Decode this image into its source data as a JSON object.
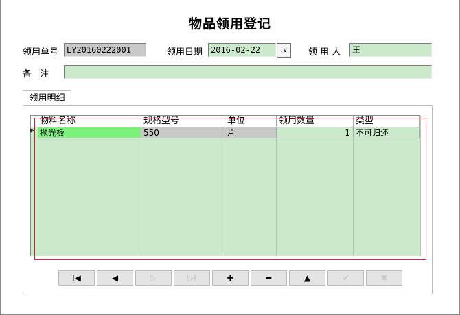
{
  "form": {
    "title": "物品领用登记",
    "doc_no_label": "领用单号",
    "doc_no_value": "LY20160222001",
    "date_label": "领用日期",
    "date_value": "2016-02-22",
    "recipient_label": "领 用 人",
    "recipient_value": "王",
    "remark_label": "备   注",
    "remark_value": ""
  },
  "tab": {
    "label": "领用明细"
  },
  "grid": {
    "columns": [
      "物料名称",
      "规格型号",
      "单位",
      "领用数量",
      "类型"
    ],
    "rows": [
      {
        "material": "抛光板",
        "spec": "550",
        "unit": "片",
        "qty": "1",
        "type": "不可归还"
      }
    ]
  },
  "navigator": {
    "buttons": [
      {
        "icon": "first-record-icon",
        "glyph": "I◀",
        "enabled": true
      },
      {
        "icon": "prior-record-icon",
        "glyph": "◀",
        "enabled": true
      },
      {
        "icon": "next-record-icon",
        "glyph": "▷",
        "enabled": false
      },
      {
        "icon": "last-record-icon",
        "glyph": "▷I",
        "enabled": false
      },
      {
        "icon": "insert-icon",
        "glyph": "✚",
        "enabled": true
      },
      {
        "icon": "delete-icon",
        "glyph": "━",
        "enabled": true
      },
      {
        "icon": "edit-icon",
        "glyph": "▲",
        "enabled": true
      },
      {
        "icon": "post-icon",
        "glyph": "✔",
        "enabled": false
      },
      {
        "icon": "cancel-icon",
        "glyph": "✖",
        "enabled": false
      }
    ]
  }
}
